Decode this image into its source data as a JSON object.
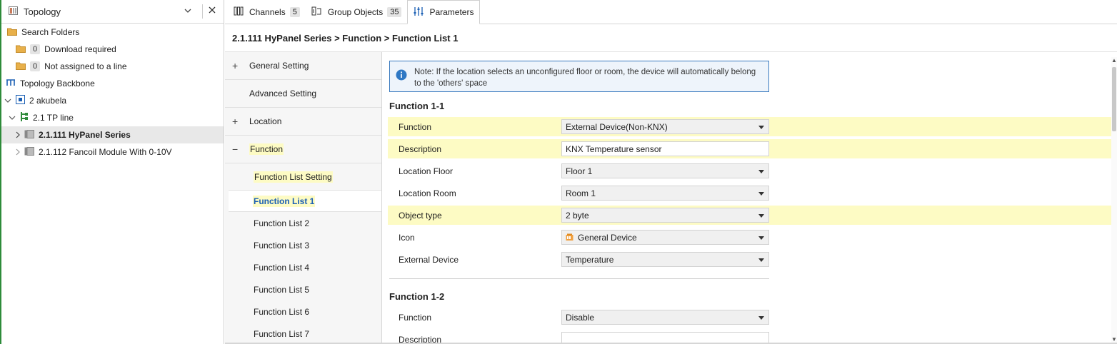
{
  "topology": {
    "title": "Topology",
    "items": [
      {
        "label": "Search Folders"
      },
      {
        "label": "Download required",
        "count": "0"
      },
      {
        "label": "Not assigned to a line",
        "count": "0"
      },
      {
        "label": "Topology Backbone"
      },
      {
        "label": "2 akubela"
      },
      {
        "label": "2.1 TP line"
      },
      {
        "label": "2.1.111 HyPanel Series"
      },
      {
        "label": "2.1.112 Fancoil Module With 0-10V"
      }
    ]
  },
  "tabs": [
    {
      "label": "Channels",
      "count": "5"
    },
    {
      "label": "Group Objects",
      "count": "35"
    },
    {
      "label": "Parameters"
    }
  ],
  "breadcrumb": "2.1.111 HyPanel Series > Function > Function List 1",
  "param_nav": {
    "groups": [
      {
        "sign": "+",
        "label": "General Setting"
      },
      {
        "sign": "",
        "label": "Advanced Setting"
      },
      {
        "sign": "+",
        "label": "Location"
      },
      {
        "sign": "−",
        "label": "Function"
      }
    ],
    "subs": [
      "Function List Setting",
      "Function List 1",
      "Function List 2",
      "Function List 3",
      "Function List 4",
      "Function List 5",
      "Function List 6",
      "Function List 7"
    ]
  },
  "note": "Note: If the location selects an unconfigured floor or room, the device will automatically belong to the 'others' space",
  "section1": {
    "title": "Function 1-1",
    "rows": [
      {
        "label": "Function",
        "value": "External Device(Non-KNX)"
      },
      {
        "label": "Description",
        "value": "KNX Temperature sensor"
      },
      {
        "label": "Location Floor",
        "value": "Floor 1"
      },
      {
        "label": "Location Room",
        "value": "Room 1"
      },
      {
        "label": "Object type",
        "value": "2 byte"
      },
      {
        "label": "Icon",
        "value": "General Device"
      },
      {
        "label": "External Device",
        "value": "Temperature"
      }
    ]
  },
  "section2": {
    "title": "Function 1-2",
    "rows": [
      {
        "label": "Function",
        "value": "Disable"
      },
      {
        "label": "Description",
        "value": ""
      }
    ]
  }
}
